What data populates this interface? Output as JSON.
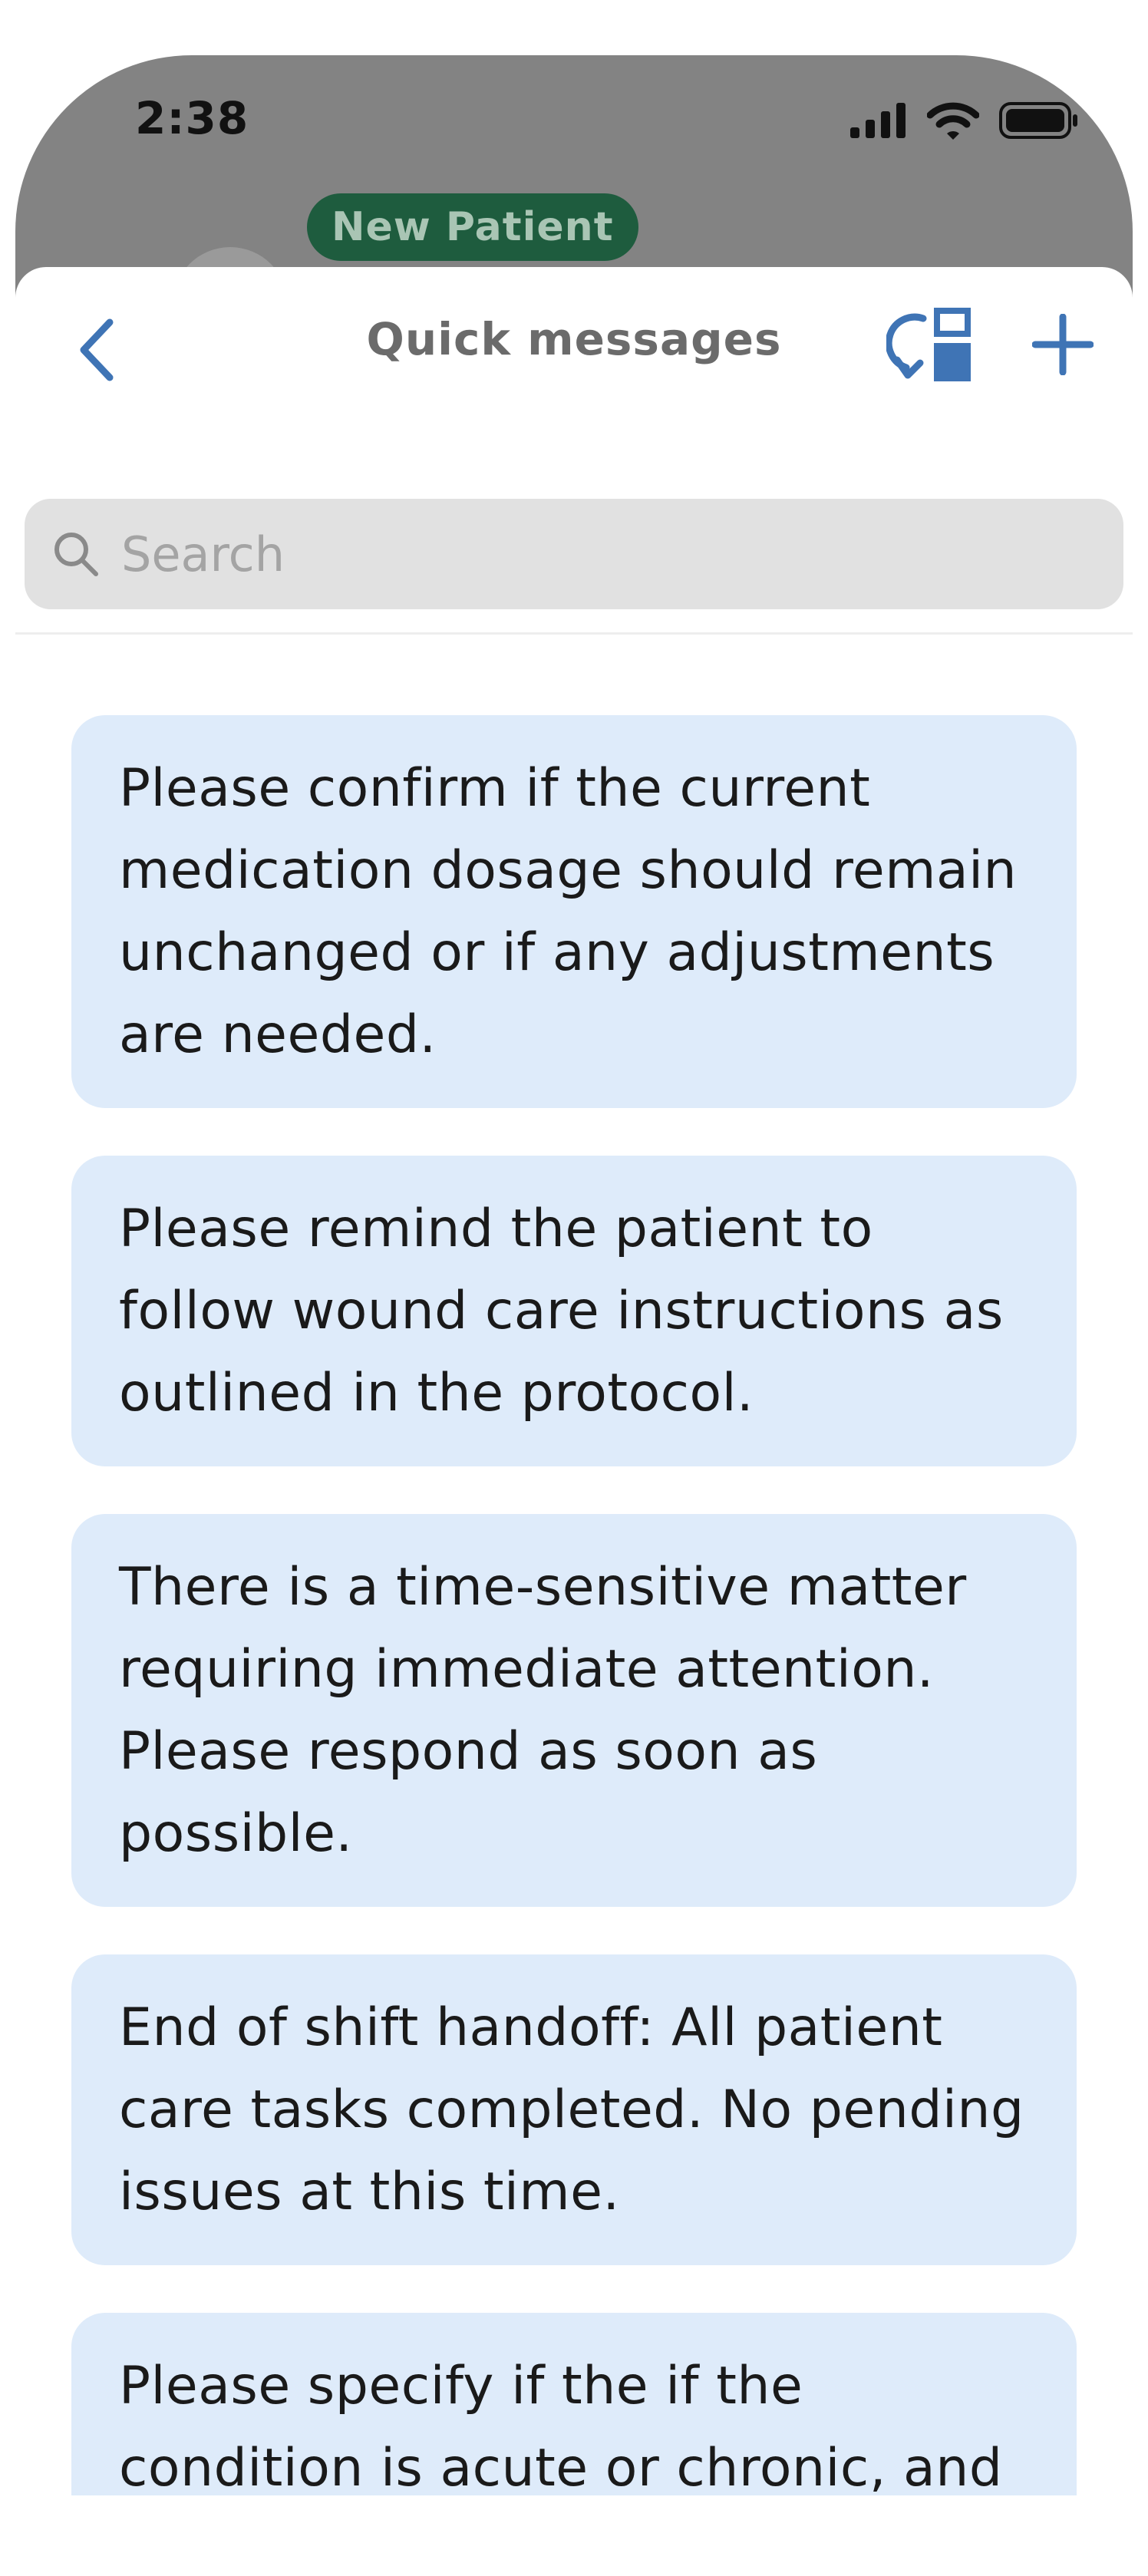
{
  "status_bar": {
    "time": "2:38"
  },
  "background": {
    "badge": "New Patient"
  },
  "nav": {
    "title": "Quick messages"
  },
  "search": {
    "placeholder": "Search"
  },
  "messages": [
    "Please confirm if the current medication dosage should remain unchanged or if any adjustments are needed.",
    "Please remind the patient to follow wound care instructions as outlined in the protocol.",
    "There is a time-sensitive matter requiring immediate attention. Please respond as soon as possible.",
    "End of shift handoff: All patient care tasks completed. No pending issues at this time.",
    "Please specify if the if the condition is acute or chronic, and indicate the severity if"
  ],
  "colors": {
    "accent": "#3f74b5",
    "card_bg": "#deebfa",
    "badge_bg": "#1e5c3e"
  }
}
